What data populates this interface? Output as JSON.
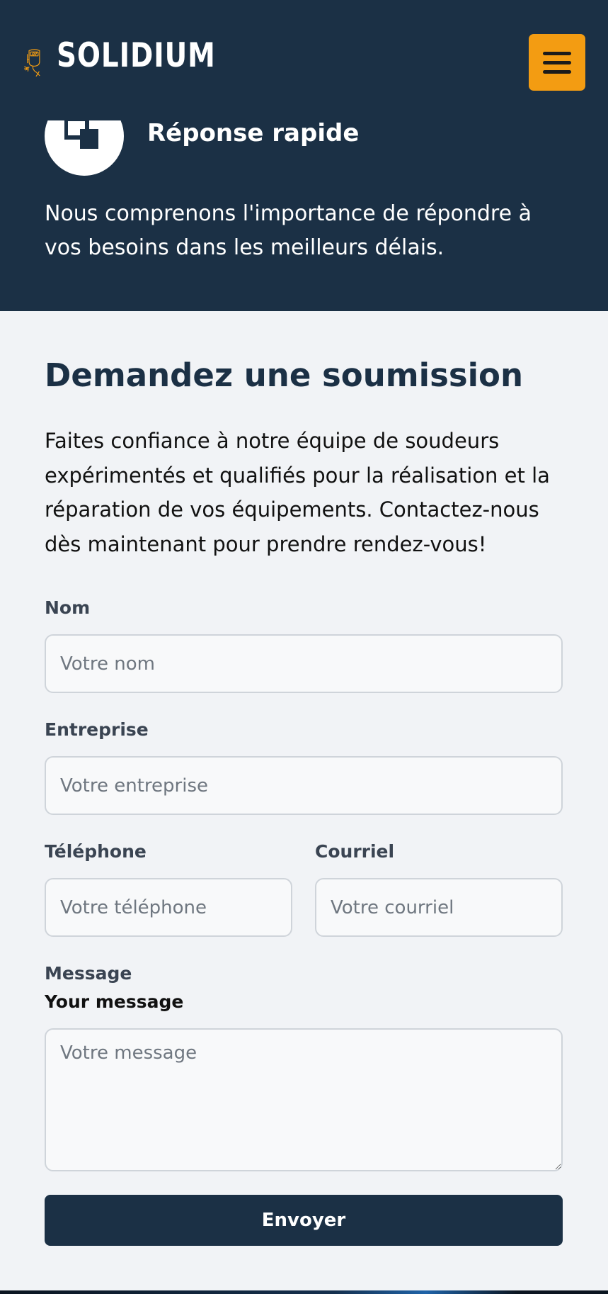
{
  "header": {
    "logo_text": "SOLIDIUM",
    "menu_icon": "hamburger-menu-icon",
    "logo_icon": "welder-mask-icon",
    "accent_color": "#f39c12",
    "header_color": "#1b3045"
  },
  "feature": {
    "icon": "quick-response-icon",
    "title": "Réponse rapide",
    "text": "Nous comprenons l'importance de répondre à vos besoins dans les meilleurs délais."
  },
  "form": {
    "title": "Demandez une soumission",
    "intro": "Faites confiance à notre équipe de soudeurs expérimentés et qualifiés pour la réalisation et la réparation de vos équipements. Contactez-nous dès maintenant pour prendre rendez-vous!",
    "name_label": "Nom",
    "name_placeholder": "Votre nom",
    "company_label": "Entreprise",
    "company_placeholder": "Votre entreprise",
    "phone_label": "Téléphone",
    "phone_placeholder": "Votre téléphone",
    "email_label": "Courriel",
    "email_placeholder": "Votre courriel",
    "message_label": "Message",
    "message_sublabel": "Your message",
    "message_placeholder": "Votre message",
    "submit_label": "Envoyer"
  }
}
